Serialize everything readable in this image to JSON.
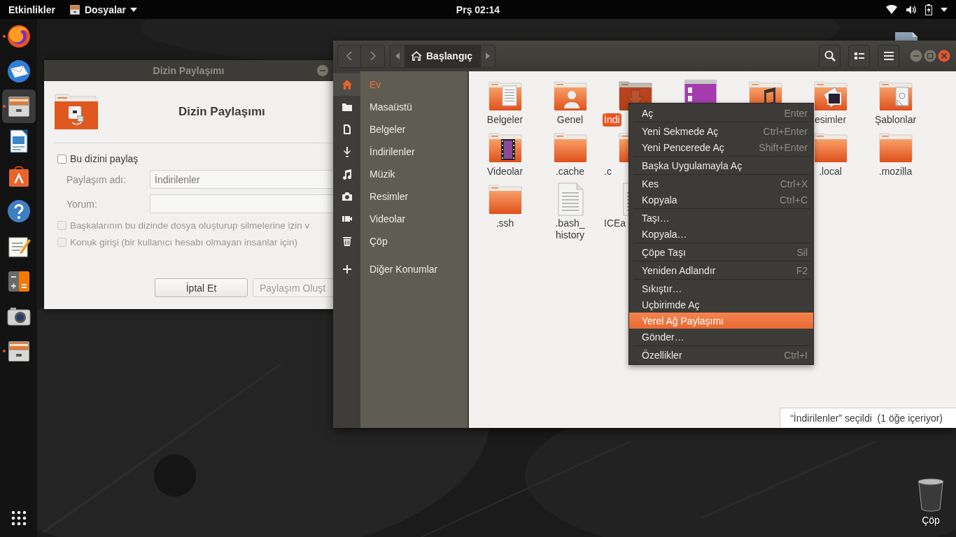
{
  "top_bar": {
    "activities": "Etkinlikler",
    "app_menu": "Dosyalar",
    "clock": "Prş 02:14"
  },
  "dock": {
    "items": [
      {
        "kind": "browser",
        "running": true,
        "selected": false
      },
      {
        "kind": "mail",
        "running": false,
        "selected": false
      },
      {
        "kind": "files",
        "running": true,
        "selected": true
      },
      {
        "kind": "impress",
        "running": false,
        "selected": false
      },
      {
        "kind": "software",
        "running": false,
        "selected": false
      },
      {
        "kind": "help",
        "running": false,
        "selected": false
      },
      {
        "kind": "editor",
        "running": false,
        "selected": false
      },
      {
        "kind": "calculator",
        "running": false,
        "selected": false
      },
      {
        "kind": "camera",
        "running": false,
        "selected": false
      },
      {
        "kind": "files",
        "running": true,
        "selected": false
      }
    ]
  },
  "share_dialog": {
    "title": "Dizin Paylaşımı",
    "heading": "Dizin Paylaşımı",
    "share_option": {
      "label": "Bu dizini paylaş",
      "checked": false
    },
    "fields": [
      {
        "label": "Paylaşım adı:",
        "value": "İndirilenler",
        "disabled": true
      },
      {
        "label": "Yorum:",
        "disabled": true
      }
    ],
    "options": [
      {
        "label": "Başkalarının bu dizinde dosya oluşturup silmelerine izin v",
        "checked": false,
        "disabled": true
      },
      {
        "label": "Konuk girişi (bir kullanıcı hesabı olmayan insanlar için)",
        "checked": false,
        "disabled": true
      }
    ],
    "buttons": [
      {
        "label": "İptal Et",
        "disabled": false
      },
      {
        "label": "Paylaşım Oluşt",
        "disabled": true
      }
    ]
  },
  "files_window": {
    "path": "Başlangıç",
    "sidebar": [
      {
        "kind": "home",
        "label": "Ev",
        "selected": true
      },
      {
        "kind": "desktop",
        "label": "Masaüstü",
        "selected": false
      },
      {
        "kind": "document",
        "label": "Belgeler",
        "selected": false
      },
      {
        "kind": "download",
        "label": "İndirilenler",
        "selected": false
      },
      {
        "kind": "music",
        "label": "Müzik",
        "selected": false
      },
      {
        "kind": "camera",
        "label": "Resimler",
        "selected": false
      },
      {
        "kind": "video",
        "label": "Videolar",
        "selected": false
      },
      {
        "kind": "trash",
        "label": "Çöp",
        "selected": false
      },
      {
        "kind": "plus",
        "label": "Diğer Konumlar",
        "selected": false
      }
    ],
    "grid_columns": [
      [
        {
          "kind": "documents",
          "label": "Belgeler",
          "selected": false
        },
        {
          "kind": "videos",
          "label": "Videolar",
          "selected": false
        },
        {
          "kind": "folder",
          "label": ".ssh",
          "selected": false
        }
      ],
      [
        {
          "kind": "public",
          "label": "Genel",
          "selected": false
        },
        {
          "kind": "folder",
          "label": ".cache",
          "selected": false
        },
        {
          "kind": "text",
          "label": ".bash_ history",
          "selected": false
        }
      ],
      [
        {
          "kind": "downloads",
          "label": "İndi",
          "selected": true
        },
        {
          "kind": "folder",
          "label": ".c",
          "selected": false
        },
        {
          "kind": "binary",
          "label": "ICEa",
          "selected": false
        }
      ],
      [
        {
          "kind": "app",
          "selected": false
        }
      ],
      [
        {
          "kind": "music",
          "selected": false
        }
      ],
      [
        {
          "kind": "pictures",
          "label": "esimler",
          "selected": false
        },
        {
          "kind": "folder",
          "label": ".local",
          "selected": false
        }
      ],
      [
        {
          "kind": "templates",
          "label": "Şablonlar",
          "selected": false
        },
        {
          "kind": "folder",
          "label": ".mozilla",
          "selected": false
        }
      ]
    ],
    "status": "“İndirilenler” seçildi  (1 öğe içeriyor)"
  },
  "context_menu": {
    "groups": [
      [
        {
          "label": "Aç",
          "shortcut": "Enter",
          "selected": false
        }
      ],
      [
        {
          "label": "Yeni Sekmede Aç",
          "shortcut": "Ctrl+Enter",
          "selected": false
        },
        {
          "label": "Yeni Pencerede Aç",
          "shortcut": "Shift+Enter",
          "selected": false
        }
      ],
      [
        {
          "label": "Başka Uygulamayla Aç",
          "selected": false
        }
      ],
      [
        {
          "label": "Kes",
          "shortcut": "Ctrl+X",
          "selected": false
        },
        {
          "label": "Kopyala",
          "shortcut": "Ctrl+C",
          "selected": false
        }
      ],
      [
        {
          "label": "Taşı…",
          "selected": false
        },
        {
          "label": "Kopyala…",
          "selected": false
        }
      ],
      [
        {
          "label": "Çöpe Taşı",
          "shortcut": "Sil",
          "selected": false
        }
      ],
      [
        {
          "label": "Yeniden Adlandır",
          "shortcut": "F2",
          "selected": false
        }
      ],
      [
        {
          "label": "Sıkıştır…",
          "selected": false
        },
        {
          "label": "Uçbirimde Aç",
          "selected": false
        },
        {
          "label": "Yerel Ağ Paylaşımı",
          "selected": true
        },
        {
          "label": "Gönder…",
          "selected": false
        }
      ],
      [
        {
          "label": "Özellikler",
          "shortcut": "Ctrl+I",
          "selected": false
        }
      ]
    ]
  },
  "desktop": {
    "trash_label": "Çöp"
  }
}
